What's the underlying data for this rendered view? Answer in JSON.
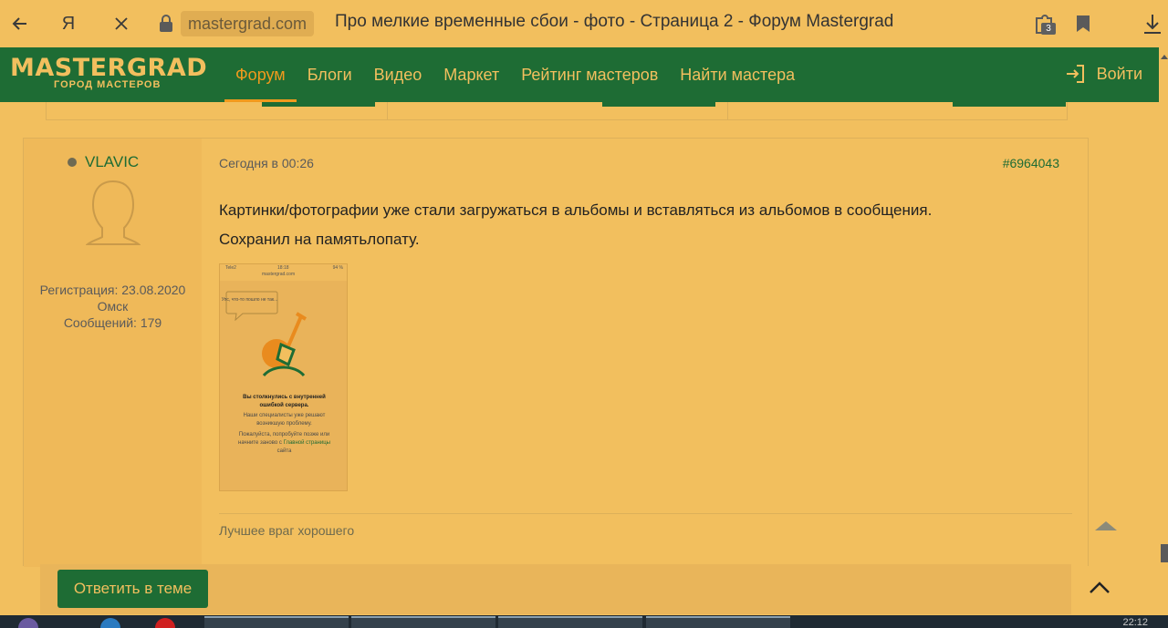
{
  "browser": {
    "url": "mastergrad.com",
    "title": "Про мелкие временные сбои - фото - Страница 2 - Форум Mastergrad",
    "extensions_badge": "3",
    "yandex_label": "Я"
  },
  "site": {
    "logo": "MASTERGRAD",
    "logo_sub": "ГОРОД МАСТЕРОВ",
    "nav": [
      "Форум",
      "Блоги",
      "Видео",
      "Маркет",
      "Рейтинг мастеров",
      "Найти мастера"
    ],
    "login": "Войти"
  },
  "post": {
    "author": "VLAVIC",
    "registration": "Регистрация: 23.08.2020",
    "city": "Омск",
    "messages": "Сообщений: 179",
    "date": "Сегодня в 00:26",
    "number": "#6964043",
    "line1": "Картинки/фотографии уже стали загружаться в альбомы и вставляться из альбомов в сообщения.",
    "line2": "Сохранил на памятьлопату.",
    "signature": "Лучшее враг хорошего",
    "screenshot": {
      "status_left": "Tele2",
      "status_time": "18:18",
      "status_right": "94 %",
      "url": "mastergrad.com",
      "bubble": "Упс, что-то пошло не так...",
      "error_title": "Вы столкнулись с внутренней ошибкой сервера.",
      "error_text1": "Наши специалисты уже решают возникшую проблему.",
      "error_text2": "Пожалуйста, попробуйте позже или начните заново с",
      "error_link": "Главной страницы",
      "error_text3": "сайта"
    }
  },
  "reply": {
    "button": "Ответить в теме"
  },
  "taskbar": {
    "clock": "22:12"
  },
  "colors": {
    "background": "#f2bf5e",
    "brand_green": "#1e6c34",
    "active_nav": "#f19a1d"
  }
}
